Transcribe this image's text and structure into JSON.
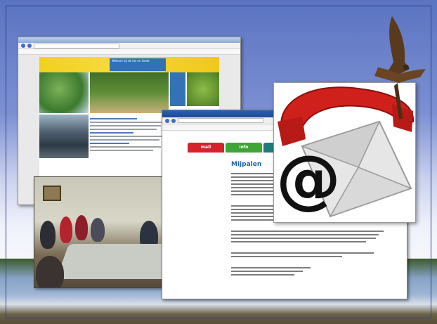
{
  "slide": {
    "colors": {
      "sky_top": "#5b74c2",
      "frame": "#2f3f7f"
    }
  },
  "browser_shot_1": {
    "icon": "browser-window",
    "banner_text": "Welkom bij de Lei en Linde"
  },
  "browser_shot_2": {
    "icon": "browser-window",
    "tabs": [
      {
        "label": "mail",
        "color": "#d5232c"
      },
      {
        "label": "info",
        "color": "#3fa535"
      },
      {
        "label": "",
        "color": "#1d7c7a"
      }
    ],
    "heading": "Mijpalen"
  },
  "meeting_photo": {
    "icon": "meeting-photo"
  },
  "contact_icon": {
    "icon": "phone-email-at-icon",
    "symbol": "@"
  },
  "bird": {
    "icon": "bird-of-prey-icon"
  }
}
